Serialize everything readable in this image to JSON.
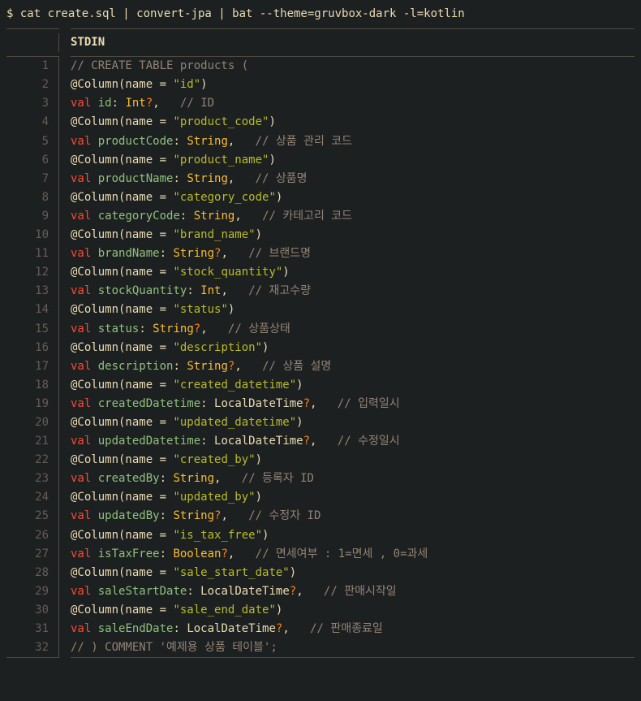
{
  "command": {
    "prompt": "$ ",
    "text": "cat create.sql | convert-jpa | bat --theme=gruvbox-dark -l=kotlin"
  },
  "header": "STDIN",
  "lines": [
    {
      "n": 1,
      "type": "comment",
      "text": "// CREATE TABLE products ("
    },
    {
      "n": 2,
      "type": "anno",
      "col": "id"
    },
    {
      "n": 3,
      "type": "decl",
      "ident": "id",
      "dtype": "Int",
      "nullable": true,
      "trailComma": true,
      "comment": "// ID"
    },
    {
      "n": 4,
      "type": "anno",
      "col": "product_code"
    },
    {
      "n": 5,
      "type": "decl",
      "ident": "productCode",
      "dtype": "String",
      "nullable": false,
      "trailComma": true,
      "comment": "// 상품 관리 코드"
    },
    {
      "n": 6,
      "type": "anno",
      "col": "product_name"
    },
    {
      "n": 7,
      "type": "decl",
      "ident": "productName",
      "dtype": "String",
      "nullable": false,
      "trailComma": true,
      "comment": "// 상품명"
    },
    {
      "n": 8,
      "type": "anno",
      "col": "category_code"
    },
    {
      "n": 9,
      "type": "decl",
      "ident": "categoryCode",
      "dtype": "String",
      "nullable": false,
      "trailComma": true,
      "comment": "// 카테고리 코드"
    },
    {
      "n": 10,
      "type": "anno",
      "col": "brand_name"
    },
    {
      "n": 11,
      "type": "decl",
      "ident": "brandName",
      "dtype": "String",
      "nullable": true,
      "trailComma": true,
      "comment": "// 브랜드명"
    },
    {
      "n": 12,
      "type": "anno",
      "col": "stock_quantity"
    },
    {
      "n": 13,
      "type": "decl",
      "ident": "stockQuantity",
      "dtype": "Int",
      "nullable": false,
      "trailComma": true,
      "comment": "// 재고수량"
    },
    {
      "n": 14,
      "type": "anno",
      "col": "status"
    },
    {
      "n": 15,
      "type": "decl",
      "ident": "status",
      "dtype": "String",
      "nullable": true,
      "trailComma": true,
      "comment": "// 상품상태"
    },
    {
      "n": 16,
      "type": "anno",
      "col": "description"
    },
    {
      "n": 17,
      "type": "decl",
      "ident": "description",
      "dtype": "String",
      "nullable": true,
      "trailComma": true,
      "comment": "// 상품 설명"
    },
    {
      "n": 18,
      "type": "anno",
      "col": "created_datetime"
    },
    {
      "n": 19,
      "type": "decl",
      "ident": "createdDatetime",
      "dtype": "LocalDateTime",
      "nullable": true,
      "trailComma": true,
      "comment": "// 입력일시"
    },
    {
      "n": 20,
      "type": "anno",
      "col": "updated_datetime"
    },
    {
      "n": 21,
      "type": "decl",
      "ident": "updatedDatetime",
      "dtype": "LocalDateTime",
      "nullable": true,
      "trailComma": true,
      "comment": "// 수정일시"
    },
    {
      "n": 22,
      "type": "anno",
      "col": "created_by"
    },
    {
      "n": 23,
      "type": "decl",
      "ident": "createdBy",
      "dtype": "String",
      "nullable": false,
      "trailComma": true,
      "comment": "// 등록자 ID"
    },
    {
      "n": 24,
      "type": "anno",
      "col": "updated_by"
    },
    {
      "n": 25,
      "type": "decl",
      "ident": "updatedBy",
      "dtype": "String",
      "nullable": true,
      "trailComma": true,
      "comment": "// 수정자 ID"
    },
    {
      "n": 26,
      "type": "anno",
      "col": "is_tax_free"
    },
    {
      "n": 27,
      "type": "decl",
      "ident": "isTaxFree",
      "dtype": "Boolean",
      "nullable": true,
      "trailComma": true,
      "comment": "// 면세여부 : 1=면세 , 0=과세"
    },
    {
      "n": 28,
      "type": "anno",
      "col": "sale_start_date"
    },
    {
      "n": 29,
      "type": "decl",
      "ident": "saleStartDate",
      "dtype": "LocalDateTime",
      "nullable": true,
      "trailComma": true,
      "comment": "// 판매시작일"
    },
    {
      "n": 30,
      "type": "anno",
      "col": "sale_end_date"
    },
    {
      "n": 31,
      "type": "decl",
      "ident": "saleEndDate",
      "dtype": "LocalDateTime",
      "nullable": true,
      "trailComma": true,
      "comment": "// 판매종료일"
    },
    {
      "n": 32,
      "type": "comment",
      "text": "// ) COMMENT '예제용 상품 테이블';"
    }
  ]
}
